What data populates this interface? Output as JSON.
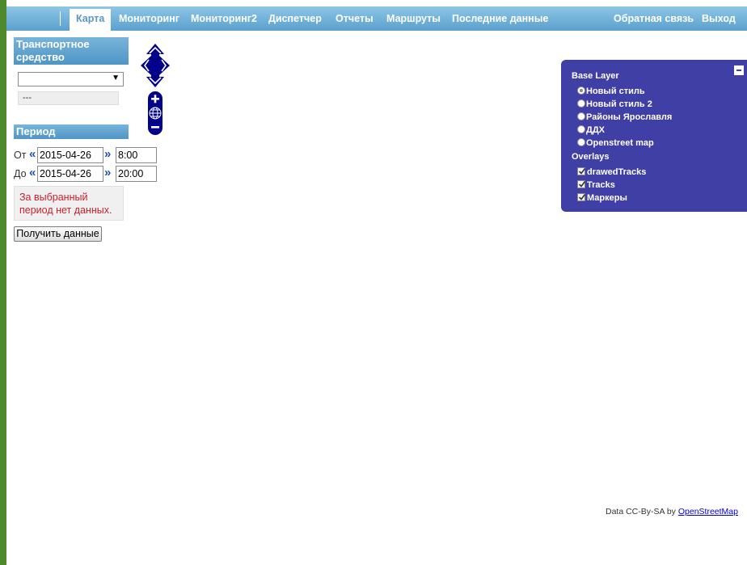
{
  "nav": {
    "items": [
      "Карта",
      "Мониторинг",
      "Мониторинг2",
      "Диспетчер",
      "Отчеты",
      "Маршруты",
      "Последние данные"
    ],
    "feedback": "Обратная связь",
    "logout": "Выход"
  },
  "sidebar": {
    "vehicle_header": "Транспортное средство",
    "vehicle_select_value": "",
    "vehicle_info": "---",
    "period_header": "Период",
    "from_label": "От",
    "to_label": "До",
    "prev_symbol": "«",
    "next_symbol": "»",
    "from_date": "2015-04-26",
    "from_time": "8:00",
    "to_date": "2015-04-26",
    "to_time": "20:00",
    "no_data_message": "За выбранный период нет данных.",
    "get_data_button": "Получить данные"
  },
  "layer_switcher": {
    "base_title": "Base Layer",
    "base_layers": [
      "Новый стиль",
      "Новый стиль 2",
      "Районы Ярославля",
      "ДДХ",
      "Openstreet map"
    ],
    "selected_base": "Новый стиль",
    "overlays_title": "Overlays",
    "overlays": [
      "drawedTracks",
      "Tracks",
      "Маркеры"
    ],
    "overlays_checked": [
      true,
      true,
      true
    ]
  },
  "attribution": {
    "prefix": "Data CC-By-SA by",
    "link": "OpenStreetMap"
  },
  "colors": {
    "nav_bar": "#5aa0cd",
    "section_header": "#4e95c6",
    "layer_switcher_bg": "#3f3fa6",
    "map_controls": "#00008b",
    "warning_text": "#cc1e2e",
    "outer_background": "#4e8a2c"
  },
  "icons": {
    "pan": "pan-arrows-icon",
    "zoom_in": "zoom-in-icon",
    "zoom_world": "zoom-world-icon",
    "zoom_out": "zoom-out-icon",
    "minimize": "minimize-icon",
    "select_arrow": "dropdown-arrow-icon"
  }
}
